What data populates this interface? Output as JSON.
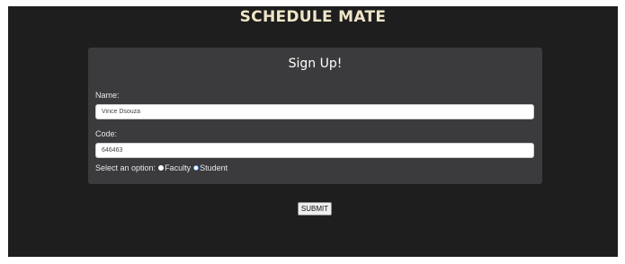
{
  "header": {
    "title": "SCHEDULE MATE"
  },
  "form": {
    "title": "Sign Up!",
    "name_label": "Name:",
    "name_value": "Vince Dsouza",
    "code_label": "Code:",
    "code_value": "646463",
    "option_prompt": "Select an option:",
    "options": [
      {
        "label": "Faculty",
        "selected": false
      },
      {
        "label": "Student",
        "selected": true
      }
    ],
    "submit_label": "SUBMIT"
  },
  "colors": {
    "background": "#1e1e1e",
    "card": "#3b3a3c",
    "title": "#efe6c8",
    "radio_selected_accent": "#5a9be8"
  }
}
